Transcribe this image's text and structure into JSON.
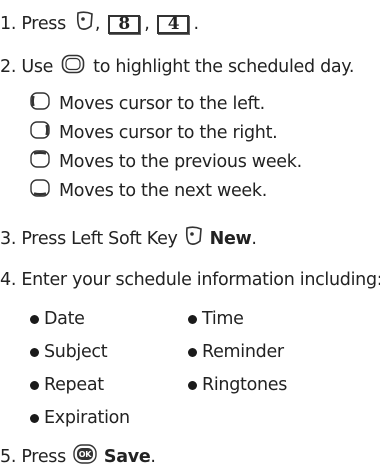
{
  "steps": {
    "s1": {
      "text": "1. Press",
      "key1": "8",
      "key2": "4",
      "sep": ",",
      "end": "."
    },
    "s2": {
      "before": "2. Use",
      "after": "to highlight the scheduled day."
    },
    "sub": [
      "Moves cursor to the left.",
      "Moves cursor to the right.",
      "Moves to the previous week.",
      "Moves to the next week."
    ],
    "s3": {
      "text": "3. Press Left Soft Key",
      "bold": "New",
      "end": "."
    },
    "s4": {
      "text": "4. Enter your schedule information including:"
    },
    "bullets": [
      "Date",
      "Time",
      "Subject",
      "Reminder",
      "Repeat",
      "Ringtones",
      "Expiration"
    ],
    "s5": {
      "text": "5. Press",
      "bold": "Save",
      "end": "."
    }
  },
  "icons": {
    "soft_key": "left-soft-key-icon",
    "nav": "navigation-key-icon",
    "nav_left": "nav-left-icon",
    "nav_right": "nav-right-icon",
    "nav_up": "nav-up-icon",
    "nav_down": "nav-down-icon",
    "ok": "ok-key-icon"
  }
}
